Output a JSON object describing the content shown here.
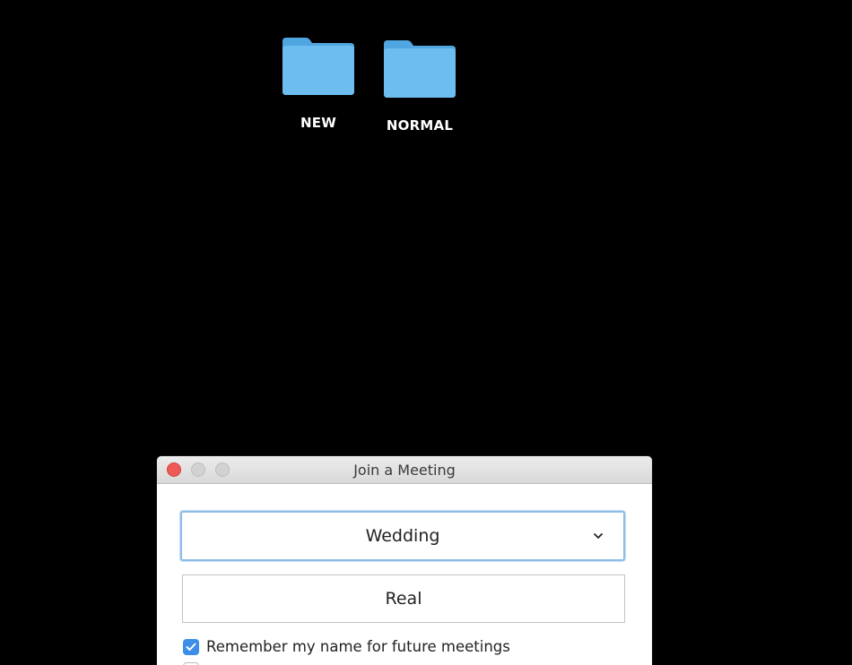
{
  "desktop": {
    "icons": [
      {
        "label": "NEW",
        "icon": "folder-icon",
        "color": "#67b7ec"
      },
      {
        "label": "NORMAL",
        "icon": "folder-icon",
        "color": "#67b7ec"
      }
    ]
  },
  "window": {
    "title": "Join a Meeting",
    "meeting_select": {
      "value": "Wedding",
      "icon": "chevron-down-icon"
    },
    "name_field": {
      "value": "Real"
    },
    "remember_checkbox": {
      "checked": true,
      "label": "Remember my name for future meetings"
    },
    "second_checkbox": {
      "checked": false
    }
  },
  "colors": {
    "desktop_background": "#000000",
    "folder": "#67b7ec",
    "close_button": "#ee5a55",
    "focus_ring": "#8fbde9",
    "checkbox_accent": "#3d8ee8"
  }
}
